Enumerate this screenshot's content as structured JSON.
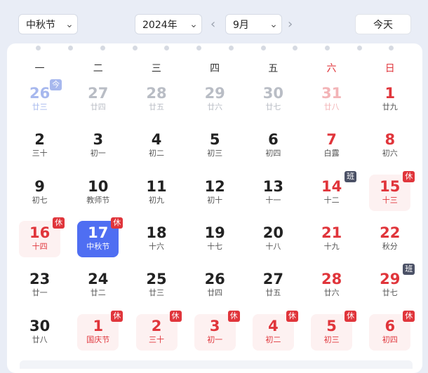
{
  "toolbar": {
    "holiday_select": "中秋节",
    "year_select": "2024年",
    "month_select": "9月",
    "prev_icon": "chevron-left-icon",
    "next_icon": "chevron-right-icon",
    "today_label": "今天"
  },
  "weekdays": [
    "一",
    "二",
    "三",
    "四",
    "五",
    "六",
    "日"
  ],
  "colors": {
    "accent": "#4f6ef2",
    "holiday": "#e0353b",
    "workday_badge": "#4b5166"
  },
  "rows": [
    [
      {
        "d": "26",
        "l": "廿三",
        "other": true,
        "badge": "今",
        "badge_type": "today",
        "today_mark": true
      },
      {
        "d": "27",
        "l": "廿四",
        "other": true
      },
      {
        "d": "28",
        "l": "廿五",
        "other": true
      },
      {
        "d": "29",
        "l": "廿六",
        "other": true
      },
      {
        "d": "30",
        "l": "廿七",
        "other": true
      },
      {
        "d": "31",
        "l": "廿八",
        "other": true
      },
      {
        "d": "1",
        "l": "廿九"
      }
    ],
    [
      {
        "d": "2",
        "l": "三十"
      },
      {
        "d": "3",
        "l": "初一"
      },
      {
        "d": "4",
        "l": "初二"
      },
      {
        "d": "5",
        "l": "初三"
      },
      {
        "d": "6",
        "l": "初四"
      },
      {
        "d": "7",
        "l": "白露"
      },
      {
        "d": "8",
        "l": "初六"
      }
    ],
    [
      {
        "d": "9",
        "l": "初七"
      },
      {
        "d": "10",
        "l": "教师节"
      },
      {
        "d": "11",
        "l": "初九"
      },
      {
        "d": "12",
        "l": "初十"
      },
      {
        "d": "13",
        "l": "十一"
      },
      {
        "d": "14",
        "l": "十二",
        "badge": "班",
        "badge_type": "work"
      },
      {
        "d": "15",
        "l": "十三",
        "rest": true,
        "badge": "休",
        "badge_type": "rest"
      }
    ],
    [
      {
        "d": "16",
        "l": "十四",
        "rest": true,
        "badge": "休",
        "badge_type": "rest"
      },
      {
        "d": "17",
        "l": "中秋节",
        "selected": true,
        "badge": "休",
        "badge_type": "rest"
      },
      {
        "d": "18",
        "l": "十六"
      },
      {
        "d": "19",
        "l": "十七"
      },
      {
        "d": "20",
        "l": "十八"
      },
      {
        "d": "21",
        "l": "十九"
      },
      {
        "d": "22",
        "l": "秋分"
      }
    ],
    [
      {
        "d": "23",
        "l": "廿一"
      },
      {
        "d": "24",
        "l": "廿二"
      },
      {
        "d": "25",
        "l": "廿三"
      },
      {
        "d": "26",
        "l": "廿四"
      },
      {
        "d": "27",
        "l": "廿五"
      },
      {
        "d": "28",
        "l": "廿六"
      },
      {
        "d": "29",
        "l": "廿七",
        "badge": "班",
        "badge_type": "work"
      }
    ],
    [
      {
        "d": "30",
        "l": "廿八"
      },
      {
        "d": "1",
        "l": "国庆节",
        "rest": true,
        "badge": "休",
        "badge_type": "rest",
        "festival": true
      },
      {
        "d": "2",
        "l": "三十",
        "rest": true,
        "badge": "休",
        "badge_type": "rest"
      },
      {
        "d": "3",
        "l": "初一",
        "rest": true,
        "badge": "休",
        "badge_type": "rest"
      },
      {
        "d": "4",
        "l": "初二",
        "rest": true,
        "badge": "休",
        "badge_type": "rest"
      },
      {
        "d": "5",
        "l": "初三",
        "rest": true,
        "badge": "休",
        "badge_type": "rest"
      },
      {
        "d": "6",
        "l": "初四",
        "rest": true,
        "badge": "休",
        "badge_type": "rest"
      }
    ]
  ]
}
